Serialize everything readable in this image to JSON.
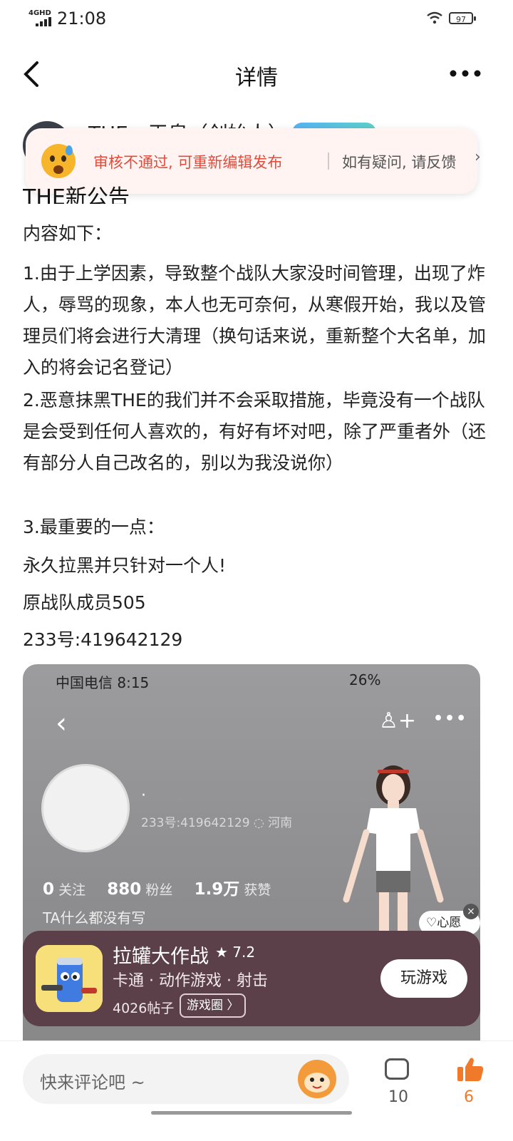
{
  "status_bar": {
    "network": "4GHD",
    "time": "21:08",
    "battery": "97"
  },
  "nav": {
    "back_icon": "chevron-left-icon",
    "title": "详情",
    "more_icon": "more-horizontal-icon"
  },
  "author": {
    "name": "THE—王皇（创始人）"
  },
  "toast": {
    "fail_text": "审核不通过, 可重新编辑发布",
    "help_text": "如有疑问, 请反馈",
    "chevron": "›"
  },
  "post": {
    "title": "THE新公告",
    "paragraphs": [
      "内容如下：",
      "1.由于上学因素，导致整个战队大家没时间管理，出现了炸人，辱骂的现象，本人也无可奈何，从寒假开始，我以及管理员们将会进行大清理（换句话来说，重新整个大名单，加入的将会记名登记）",
      "2.恶意抹黑THE的我们并不会采取措施，毕竟没有一个战队是会受到任何人喜欢的，有好有坏对吧，除了严重者外（还有部分人自己改名的，别以为我没说你）",
      "3.最重要的一点：",
      "永久拉黑并只针对一个人!",
      "原战队成员505",
      "233号:419642129"
    ]
  },
  "screenshot": {
    "carrier_time": "中国电信 8:15",
    "status_right": "26%",
    "back": "‹",
    "add_friend": "♙+",
    "more": "•••",
    "nickname": "·",
    "id_location": "233号:419642129  ◌ 河南",
    "follow_count": "0",
    "follow_label": "关注",
    "fans_count": "880",
    "fans_label": "粉丝",
    "likes_count": "1.9万",
    "likes_label": "获赞",
    "bio": "TA什么都没有写",
    "wish_label": "♡心愿单",
    "wish_close": "×"
  },
  "game": {
    "name": "拉罐大作战",
    "rating": "★ 7.2",
    "tags": "卡通 · 动作游戏 · 射击",
    "posts": "4026帖子",
    "circle": "游戏圈 〉",
    "play": "玩游戏"
  },
  "bottom": {
    "placeholder": "快来评论吧 ~",
    "comment_count": "10",
    "like_count": "6"
  }
}
